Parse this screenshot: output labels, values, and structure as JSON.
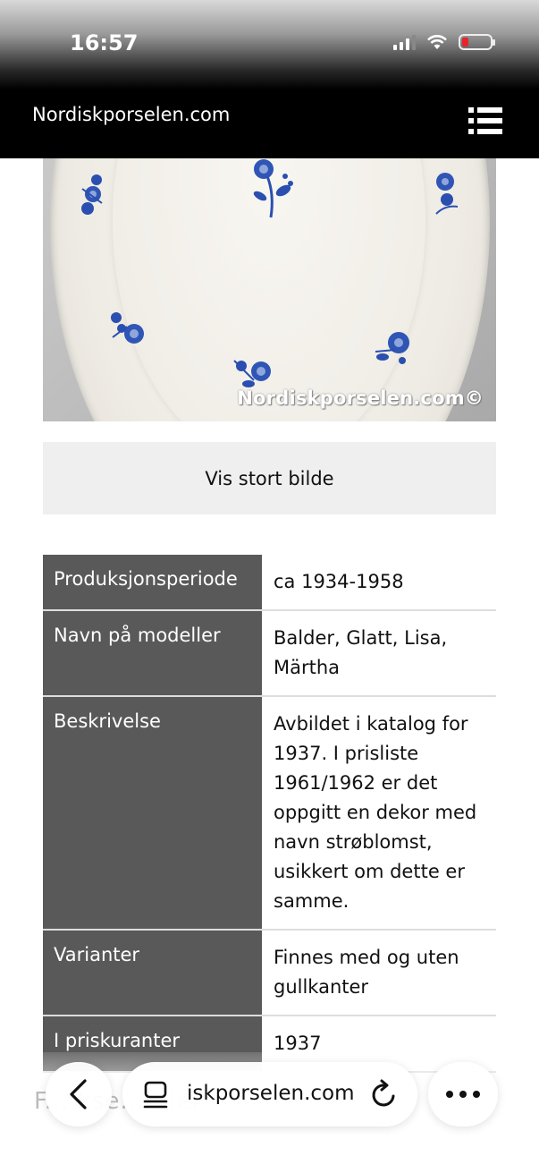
{
  "status_bar": {
    "time": "16:57"
  },
  "header": {
    "site_title": "Nordiskporselen.com",
    "menu_icon": "menu-list-icon"
  },
  "image": {
    "watermark": "Nordiskporselen.com©"
  },
  "actions": {
    "view_large": "Vis stort bilde"
  },
  "details": [
    {
      "label": "Produksjonsperiode",
      "value": "ca 1934-1958"
    },
    {
      "label": "Navn på modeller",
      "value": "Balder, Glatt, Lisa, Märtha"
    },
    {
      "label": "Beskrivelse",
      "value": "Avbildet i katalog for 1937. I prisliste 1961/1962 er det oppgitt en dekor med navn strøblomst, usikkert om dette er samme."
    },
    {
      "label": "Varianter",
      "value": "Finnes med og uten gullkanter"
    },
    {
      "label": "I priskuranter",
      "value": "1937"
    }
  ],
  "browser": {
    "url": "iskporselen.com",
    "partial_heading": "F... kse... pler"
  },
  "colors": {
    "label_bg": "#595959",
    "button_bg": "#efefef",
    "battery_low": "#e5252a",
    "flower_blue": "#2a4fb0"
  }
}
